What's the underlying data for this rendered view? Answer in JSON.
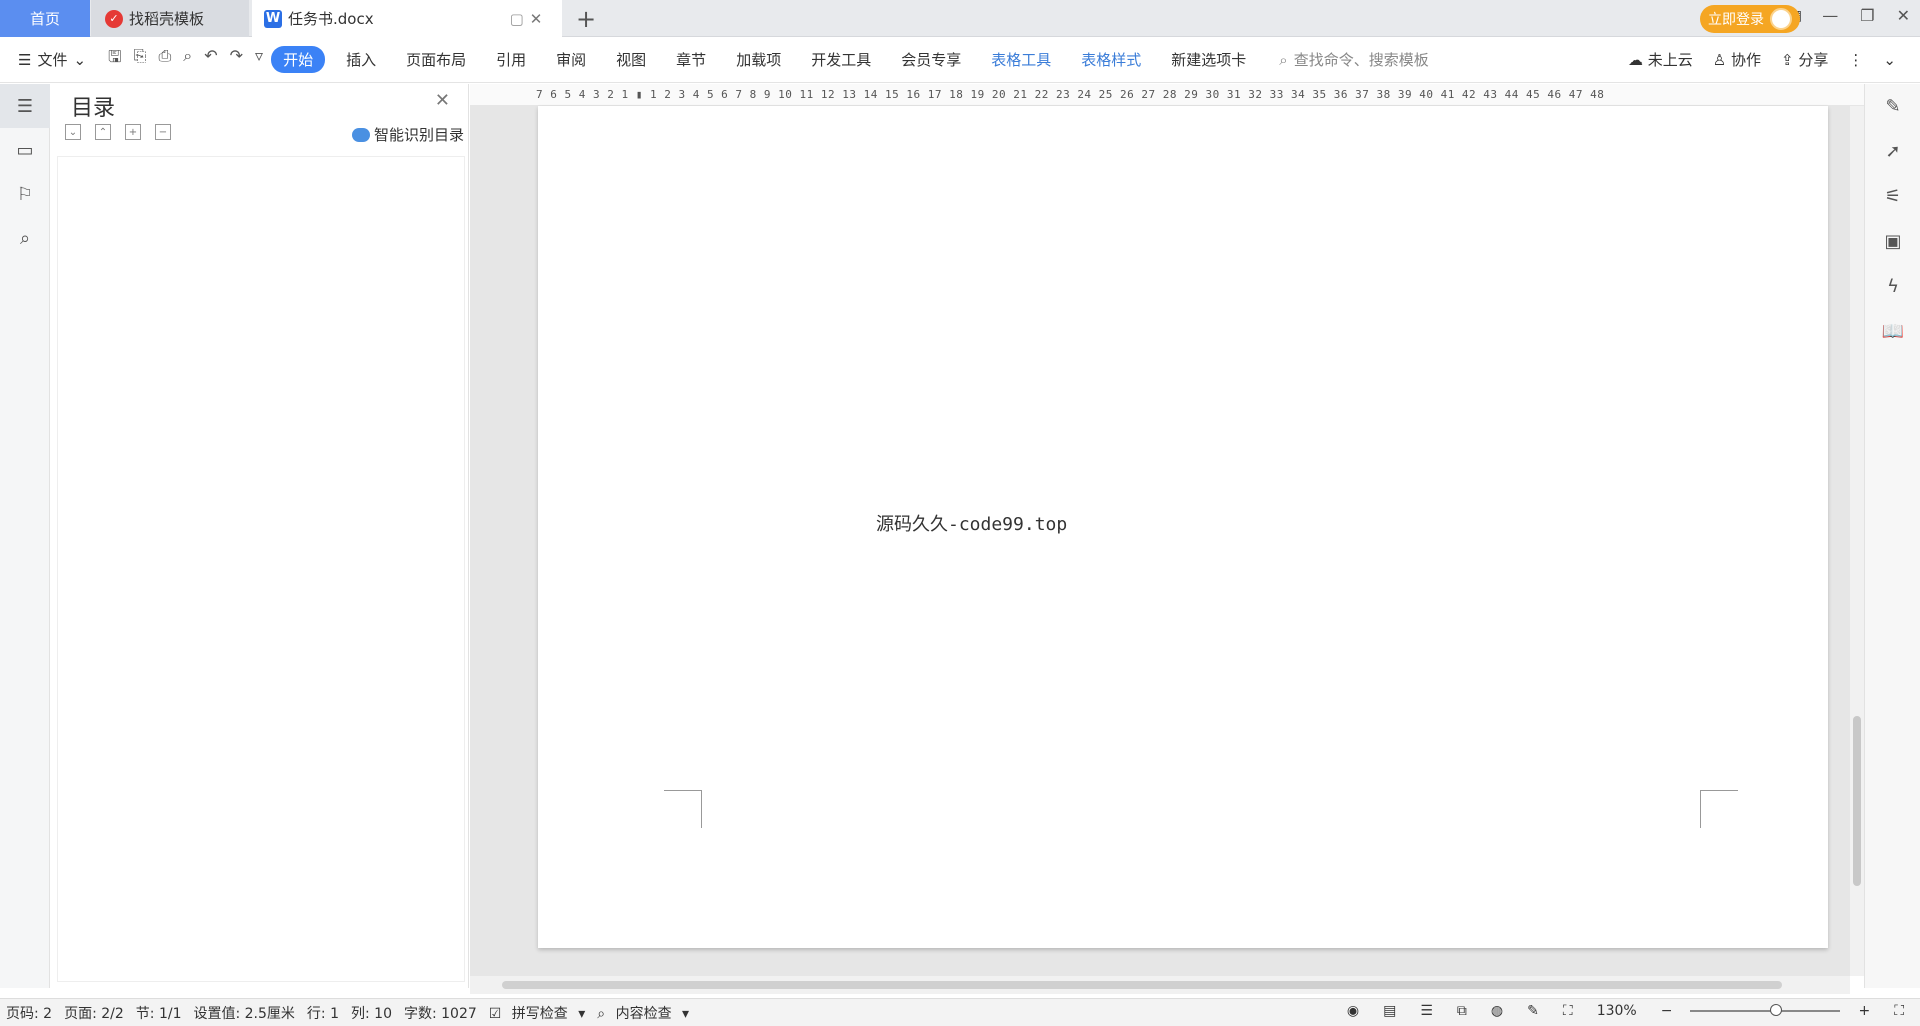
{
  "tabs": {
    "home": "首页",
    "dao": "找稻壳模板",
    "doc": "任务书.docx"
  },
  "header": {
    "login": "立即登录"
  },
  "toolbar": {
    "file": "文件",
    "menu": [
      "开始",
      "插入",
      "页面布局",
      "引用",
      "审阅",
      "视图",
      "章节",
      "加载项",
      "开发工具",
      "会员专享",
      "表格工具",
      "表格样式",
      "新建选项卡"
    ],
    "search_placeholder": "查找命令、搜索模板",
    "cloud": "未上云",
    "collab": "协作",
    "share": "分享"
  },
  "nav": {
    "title": "目录",
    "ai": "智能识别目录"
  },
  "ruler": "7  6  5  4  3  2  1  ▮  1  2  3  4  5  6  7  8  9 10 11 12 13 14 15 16 17 18 19 20 21 22 23 24 25 26 27 28 29 30 31 32 33 34 35 36 37 38 39 40 41 42 43 44 45 46 47 48",
  "page": {
    "text": "源码久久-code99.top"
  },
  "status": {
    "page_no": "页码: 2",
    "pages": "页面: 2/2",
    "section": "节: 1/1",
    "setting": "设置值: 2.5厘米",
    "row": "行: 1",
    "col": "列: 10",
    "words": "字数: 1027",
    "spell": "拼写检查",
    "content": "内容检查"
  },
  "zoom": {
    "value": "130%",
    "level_percent": 130
  },
  "colors": {
    "accent": "#3b82f6",
    "login": "#f5a623",
    "home_tab": "#5b8ef0"
  }
}
